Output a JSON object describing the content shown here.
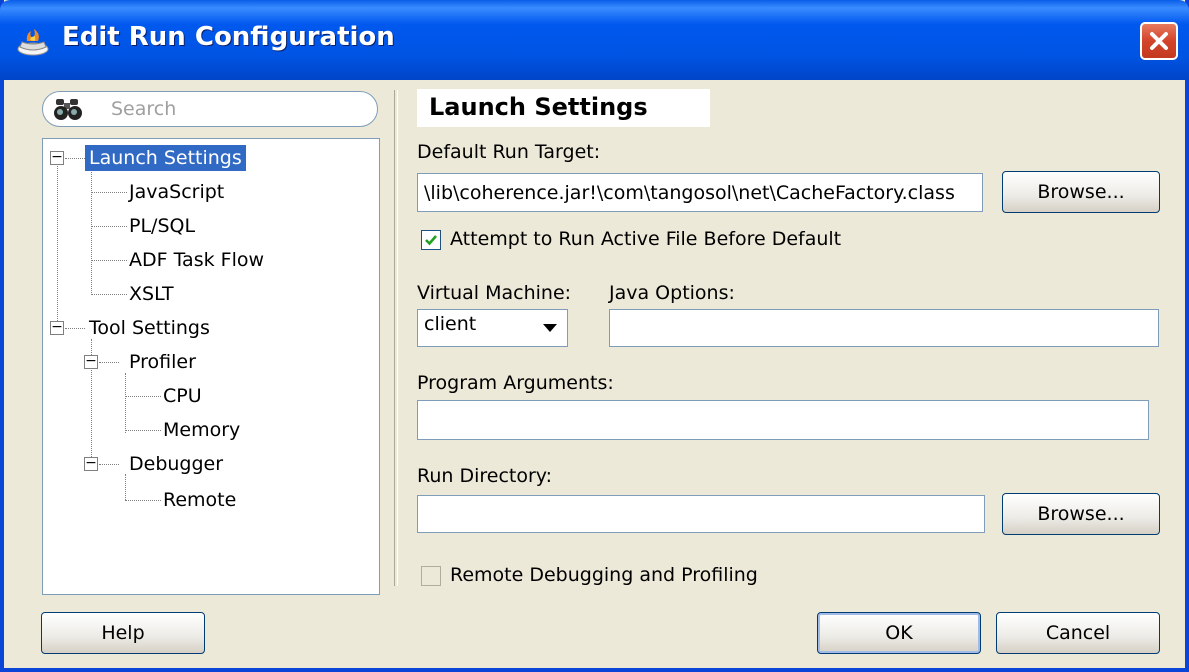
{
  "window": {
    "title": "Edit Run Configuration",
    "close_icon": "close-icon"
  },
  "search": {
    "placeholder": "Search",
    "icon": "binoculars-icon"
  },
  "tree": {
    "items": [
      {
        "label": "Launch Settings",
        "level": 0,
        "expandable": true,
        "selected": true
      },
      {
        "label": "JavaScript",
        "level": 1
      },
      {
        "label": "PL/SQL",
        "level": 1
      },
      {
        "label": "ADF Task Flow",
        "level": 1
      },
      {
        "label": "XSLT",
        "level": 1
      },
      {
        "label": "Tool Settings",
        "level": 0,
        "expandable": true
      },
      {
        "label": "Profiler",
        "level": 1,
        "expandable": true
      },
      {
        "label": "CPU",
        "level": 2
      },
      {
        "label": "Memory",
        "level": 2
      },
      {
        "label": "Debugger",
        "level": 1,
        "expandable": true
      },
      {
        "label": "Remote",
        "level": 2
      }
    ]
  },
  "panel": {
    "heading": "Launch Settings",
    "default_run_target": {
      "label": "Default Run Target:",
      "value": "\\lib\\coherence.jar!\\com\\tangosol\\net\\CacheFactory.class",
      "browse_label": "Browse..."
    },
    "attempt_active": {
      "label": "Attempt to Run Active File Before Default",
      "checked": true
    },
    "virtual_machine": {
      "label": "Virtual Machine:",
      "selected": "client"
    },
    "java_options": {
      "label": "Java Options:",
      "value": ""
    },
    "program_arguments": {
      "label": "Program Arguments:",
      "value": ""
    },
    "run_directory": {
      "label": "Run Directory:",
      "value": "",
      "browse_label": "Browse..."
    },
    "remote_debugging": {
      "label": "Remote Debugging and Profiling",
      "checked": false
    }
  },
  "footer": {
    "help_label": "Help",
    "ok_label": "OK",
    "cancel_label": "Cancel"
  },
  "colors": {
    "titlebar": "#0054e3",
    "selection": "#316ac5",
    "dialog_bg": "#ece9d8"
  }
}
